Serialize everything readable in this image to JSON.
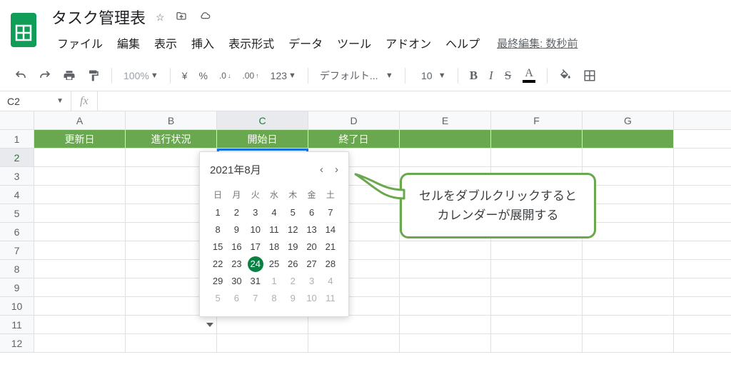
{
  "doc": {
    "title": "タスク管理表",
    "last_edit": "最終編集: 数秒前"
  },
  "menu": [
    "ファイル",
    "編集",
    "表示",
    "挿入",
    "表示形式",
    "データ",
    "ツール",
    "アドオン",
    "ヘルプ"
  ],
  "toolbar": {
    "zoom": "100%",
    "currency": "¥",
    "percent": "%",
    "dec_dec": ".0",
    "dec_inc": ".00",
    "more_fmt": "123",
    "font": "デフォルト...",
    "size": "10"
  },
  "namebox": {
    "cell": "C2",
    "fx": "fx"
  },
  "columns": [
    "A",
    "B",
    "C",
    "D",
    "E",
    "F",
    "G"
  ],
  "rows": [
    "1",
    "2",
    "3",
    "4",
    "5",
    "6",
    "7",
    "8",
    "9",
    "10",
    "11",
    "12"
  ],
  "headers": [
    "更新日",
    "進行状況",
    "開始日",
    "終了日"
  ],
  "datepicker": {
    "month": "2021年8月",
    "dow": [
      "日",
      "月",
      "火",
      "水",
      "木",
      "金",
      "土"
    ],
    "weeks": [
      [
        {
          "d": 1
        },
        {
          "d": 2
        },
        {
          "d": 3
        },
        {
          "d": 4
        },
        {
          "d": 5
        },
        {
          "d": 6
        },
        {
          "d": 7
        }
      ],
      [
        {
          "d": 8
        },
        {
          "d": 9
        },
        {
          "d": 10
        },
        {
          "d": 11
        },
        {
          "d": 12
        },
        {
          "d": 13
        },
        {
          "d": 14
        }
      ],
      [
        {
          "d": 15
        },
        {
          "d": 16
        },
        {
          "d": 17
        },
        {
          "d": 18
        },
        {
          "d": 19
        },
        {
          "d": 20
        },
        {
          "d": 21
        }
      ],
      [
        {
          "d": 22
        },
        {
          "d": 23
        },
        {
          "d": 24,
          "today": true
        },
        {
          "d": 25
        },
        {
          "d": 26
        },
        {
          "d": 27
        },
        {
          "d": 28
        }
      ],
      [
        {
          "d": 29
        },
        {
          "d": 30
        },
        {
          "d": 31
        },
        {
          "d": 1,
          "o": true
        },
        {
          "d": 2,
          "o": true
        },
        {
          "d": 3,
          "o": true
        },
        {
          "d": 4,
          "o": true
        }
      ],
      [
        {
          "d": 5,
          "o": true
        },
        {
          "d": 6,
          "o": true
        },
        {
          "d": 7,
          "o": true
        },
        {
          "d": 8,
          "o": true
        },
        {
          "d": 9,
          "o": true
        },
        {
          "d": 10,
          "o": true
        },
        {
          "d": 11,
          "o": true
        }
      ]
    ]
  },
  "callout": {
    "line1": "セルをダブルクリックすると",
    "line2": "カレンダーが展開する"
  }
}
